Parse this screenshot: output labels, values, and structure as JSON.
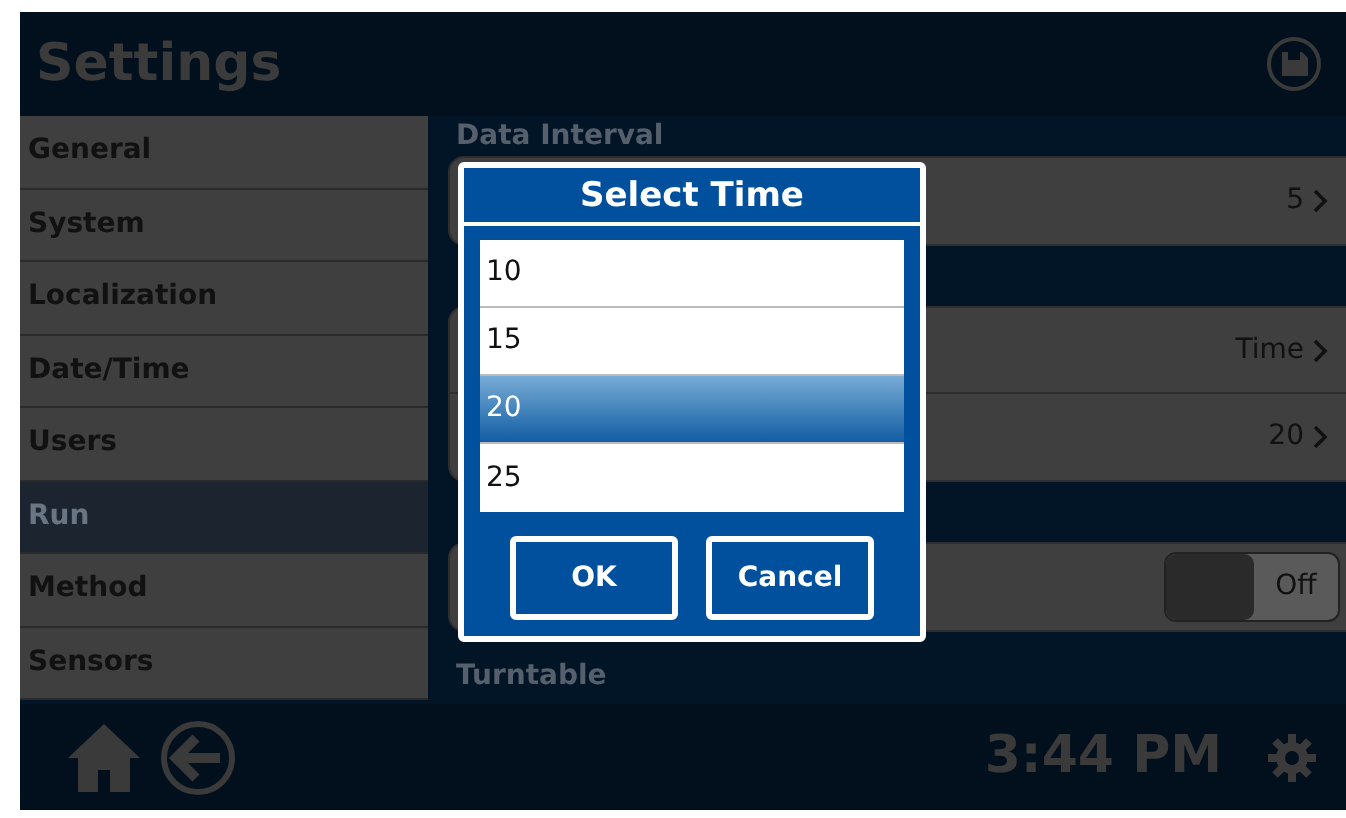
{
  "header": {
    "title": "Settings"
  },
  "sidebar": {
    "items": [
      {
        "label": "General",
        "selected": false
      },
      {
        "label": "System",
        "selected": false
      },
      {
        "label": "Localization",
        "selected": false
      },
      {
        "label": "Date/Time",
        "selected": false
      },
      {
        "label": "Users",
        "selected": false
      },
      {
        "label": "Run",
        "selected": true
      },
      {
        "label": "Method",
        "selected": false
      },
      {
        "label": "Sensors",
        "selected": false
      }
    ]
  },
  "panel": {
    "sections": [
      {
        "heading": "Data Interval",
        "rows": [
          {
            "kind": "link",
            "value": "5"
          }
        ]
      },
      {
        "rows": [
          {
            "kind": "link",
            "value": "Time"
          },
          {
            "kind": "link",
            "value": "20"
          }
        ]
      },
      {
        "rows": [
          {
            "kind": "toggle",
            "on": false,
            "value": "Off"
          }
        ]
      },
      {
        "heading": "Turntable"
      }
    ]
  },
  "dialog": {
    "title": "Select Time",
    "options": [
      {
        "label": "10",
        "selected": false
      },
      {
        "label": "15",
        "selected": false
      },
      {
        "label": "20",
        "selected": true
      },
      {
        "label": "25",
        "selected": false
      }
    ],
    "buttons": [
      "OK",
      "Cancel"
    ]
  },
  "footer": {
    "time": "3:44 PM"
  }
}
